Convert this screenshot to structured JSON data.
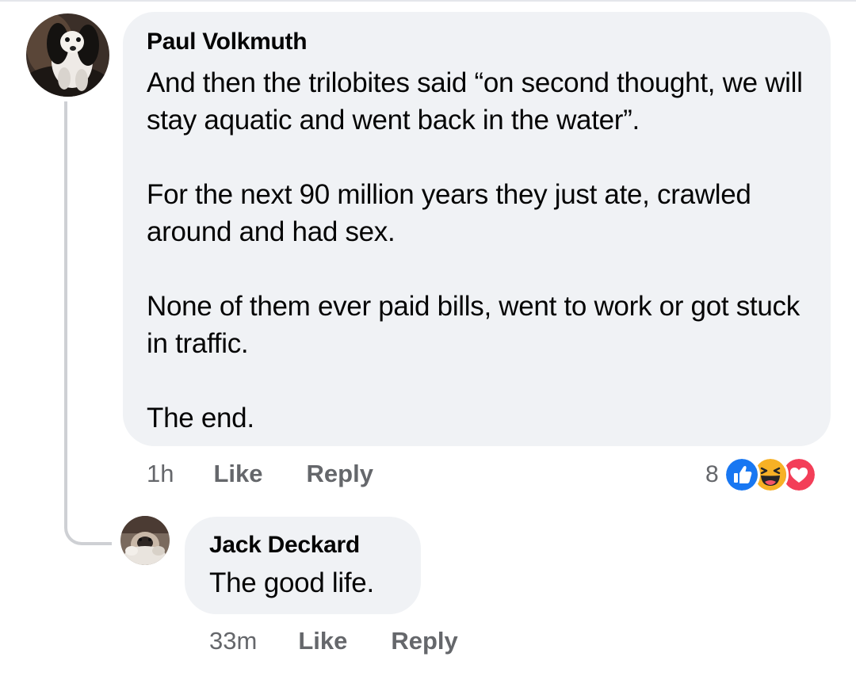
{
  "comment": {
    "author": "Paul Volkmuth",
    "paragraphs": [
      "And then the trilobites said “on second thought, we will stay aquatic and went back in the water”.",
      "For the next  90 million years they just ate, crawled around and had sex.",
      "None of them ever paid bills, went to work or got stuck in traffic.",
      "The end."
    ],
    "time": "1h",
    "like_label": "Like",
    "reply_label": "Reply",
    "reaction_count": "8",
    "reaction_icons": [
      "like-icon",
      "haha-icon",
      "love-icon"
    ]
  },
  "reply": {
    "author": "Jack Deckard",
    "text": "The good life.",
    "time": "33m",
    "like_label": "Like",
    "reply_label": "Reply"
  },
  "colors": {
    "bubble": "#f0f2f5",
    "secondary_text": "#65676b",
    "like_blue": "#1877f2",
    "love_red": "#f33e58",
    "haha_yellow": "#f7b125"
  }
}
